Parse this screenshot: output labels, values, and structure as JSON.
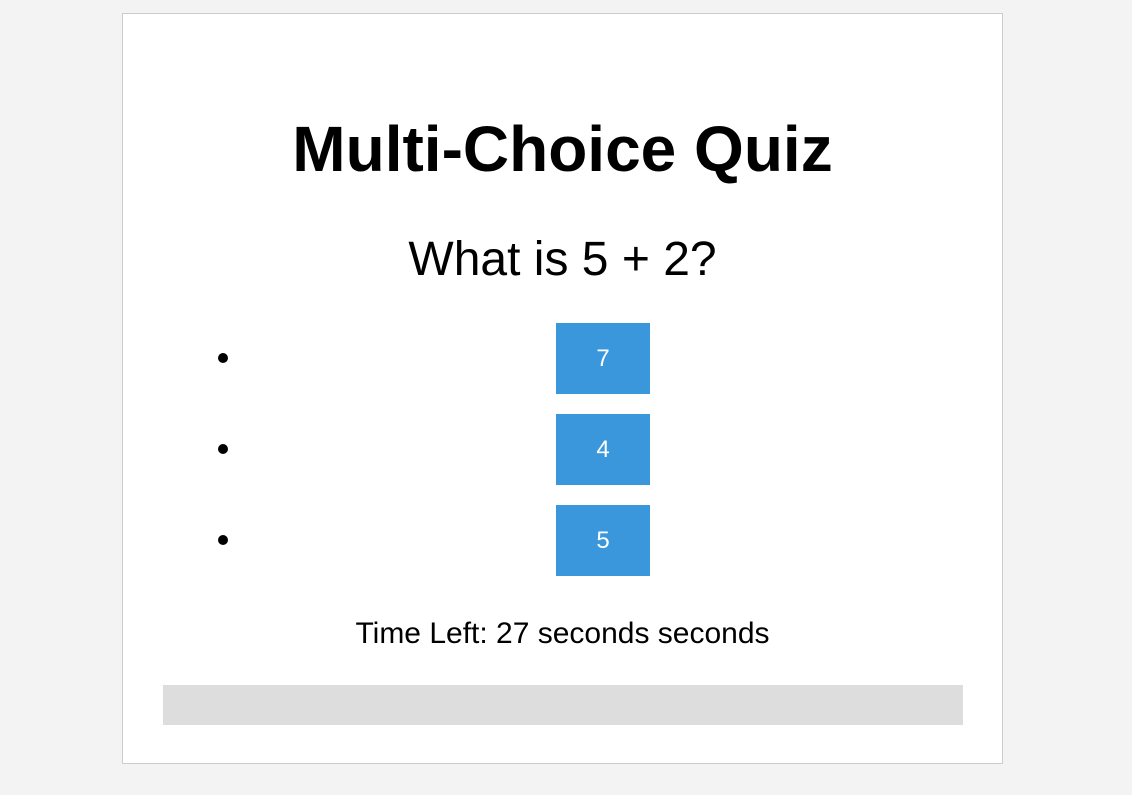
{
  "quiz": {
    "title": "Multi-Choice Quiz",
    "question": "What is 5 + 2?",
    "options": [
      {
        "label": "7"
      },
      {
        "label": "4"
      },
      {
        "label": "5"
      }
    ],
    "timer_text": "Time Left: 27 seconds seconds",
    "progress_fraction": 0
  },
  "colors": {
    "page_background": "#f3f3f3",
    "card_background": "#ffffff",
    "card_border": "#cccccc",
    "option_button": "#3a97dc",
    "option_text": "#ffffff",
    "progress_track": "#dddddd"
  }
}
